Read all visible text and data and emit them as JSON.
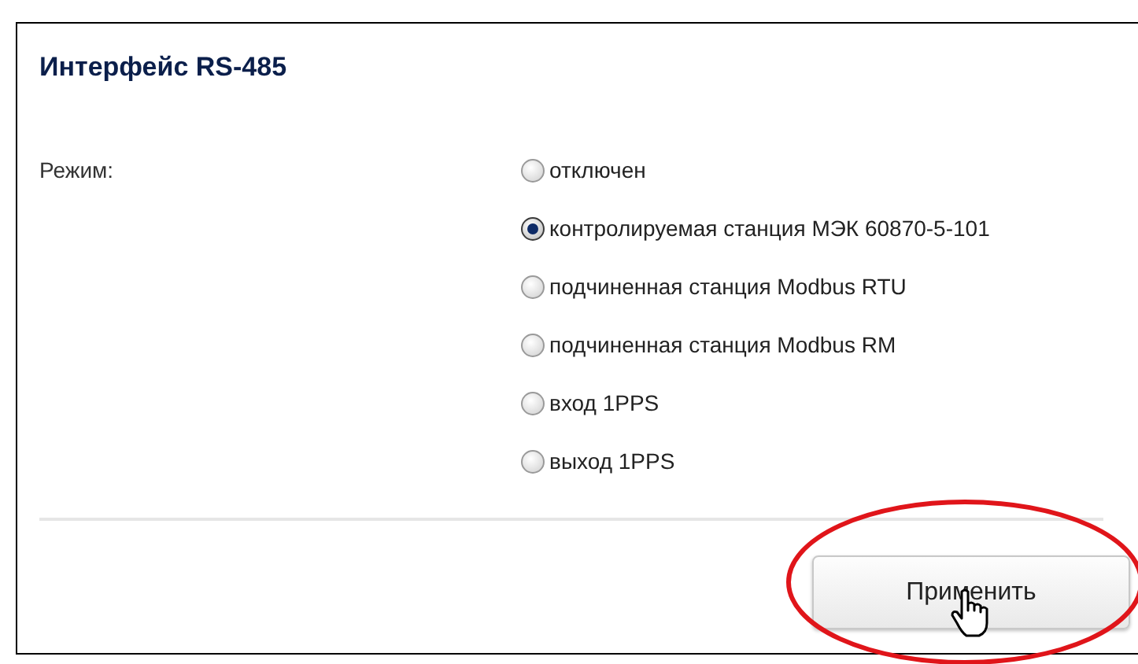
{
  "panel": {
    "title": "Интерфейс RS-485"
  },
  "mode": {
    "label": "Режим:",
    "options": [
      {
        "label": "отключен",
        "selected": false
      },
      {
        "label": "контролируемая станция МЭК 60870-5-101",
        "selected": true
      },
      {
        "label": "подчиненная станция Modbus RTU",
        "selected": false
      },
      {
        "label": "подчиненная станция Modbus RM",
        "selected": false
      },
      {
        "label": "вход 1PPS",
        "selected": false
      },
      {
        "label": "выход 1PPS",
        "selected": false
      }
    ]
  },
  "apply_button": {
    "label": "Применить"
  }
}
